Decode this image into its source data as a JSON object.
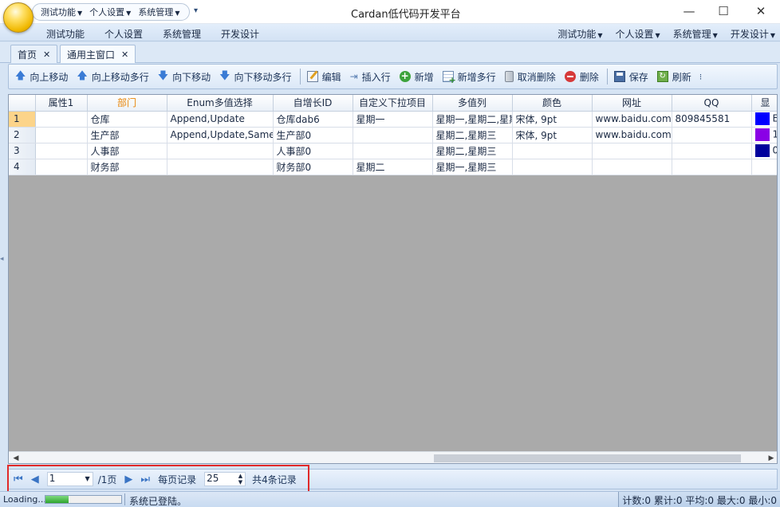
{
  "window": {
    "title": "Cardan低代码开发平台",
    "quick_access": [
      "测试功能",
      "个人设置",
      "系统管理"
    ],
    "controls": {
      "minimize": "—",
      "maximize": "☐",
      "close": "✕"
    }
  },
  "menu": {
    "left": [
      "测试功能",
      "个人设置",
      "系统管理",
      "开发设计"
    ],
    "right": [
      "测试功能",
      "个人设置",
      "系统管理",
      "开发设计"
    ]
  },
  "tabs": [
    {
      "label": "首页",
      "close": "✕"
    },
    {
      "label": "通用主窗口",
      "close": "✕",
      "active": true
    }
  ],
  "toolbar": {
    "buttons": [
      {
        "label": "向上移动",
        "icon": "arrow-up-icon"
      },
      {
        "label": "向上移动多行",
        "icon": "arrow-up-icon"
      },
      {
        "label": "向下移动",
        "icon": "arrow-down-icon"
      },
      {
        "label": "向下移动多行",
        "icon": "arrow-down-icon"
      },
      {
        "label": "编辑",
        "icon": "edit-icon"
      },
      {
        "label": "插入行",
        "icon": "insert-row-icon"
      },
      {
        "label": "新增",
        "icon": "add-icon"
      },
      {
        "label": "新增多行",
        "icon": "add-rows-icon"
      },
      {
        "label": "取消删除",
        "icon": "undelete-icon"
      },
      {
        "label": "删除",
        "icon": "delete-icon"
      },
      {
        "label": "保存",
        "icon": "save-icon"
      },
      {
        "label": "刷新",
        "icon": "refresh-icon"
      }
    ]
  },
  "grid": {
    "columns": [
      "属性1",
      "部门",
      "Enum多值选择",
      "自增长ID",
      "自定义下拉项目",
      "多值列",
      "颜色",
      "网址",
      "QQ",
      "显"
    ],
    "rows": [
      {
        "no": "1",
        "cells": [
          "",
          "仓库",
          "Append,Update",
          "仓库dab6",
          "星期一",
          "星期一,星期二,星期",
          "宋体, 9pt",
          "www.baidu.com",
          "809845581",
          "E"
        ],
        "color": "#0000ff"
      },
      {
        "no": "2",
        "cells": [
          "",
          "生产部",
          "Append,Update,Same",
          "生产部0",
          "",
          "星期二,星期三",
          "宋体, 9pt",
          "www.baidu.com",
          "",
          "1"
        ],
        "color": "#8a00e6"
      },
      {
        "no": "3",
        "cells": [
          "",
          "人事部",
          "",
          "人事部0",
          "",
          "星期二,星期三",
          "",
          "",
          "",
          "0"
        ],
        "color": "#00009c"
      },
      {
        "no": "4",
        "cells": [
          "",
          "财务部",
          "",
          "财务部0",
          "星期二",
          "星期一,星期三",
          "",
          "",
          "",
          ""
        ],
        "color": null
      }
    ]
  },
  "pager": {
    "current_page": "1",
    "total_pages": "/1页",
    "per_page_label": "每页记录",
    "per_page_value": "25",
    "total_records": "共4条记录"
  },
  "status": {
    "loading": "Loading...",
    "progress": 0.3,
    "message": "系统已登陆。",
    "stats": "计数:0 累计:0 平均:0 最大:0 最小:0"
  }
}
